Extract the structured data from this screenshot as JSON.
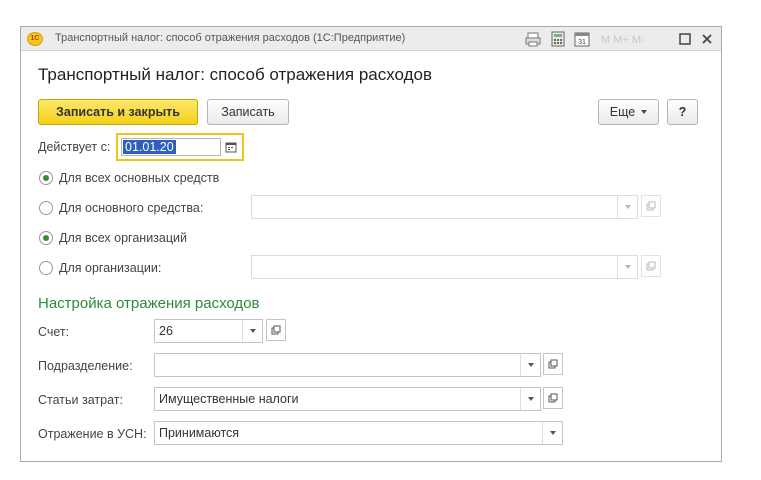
{
  "window": {
    "title": "Транспортный налог: способ отражения расходов  (1С:Предприятие)",
    "logo_text": "1С"
  },
  "titlebar_icons": [
    "print-icon",
    "calculator-icon",
    "calendar-icon",
    "m-icons",
    "maximize-icon",
    "close-icon"
  ],
  "form": {
    "title": "Транспортный налог: способ отражения расходов"
  },
  "toolbar": {
    "save_close_label": "Записать и закрыть",
    "save_label": "Записать",
    "more_label": "Еще",
    "help_label": "?"
  },
  "valid_from": {
    "label": "Действует с:",
    "value": "01.01.20"
  },
  "options": {
    "all_assets": {
      "label": "Для всех основных средств",
      "checked": true
    },
    "one_asset": {
      "label": "Для основного средства:",
      "checked": false,
      "value": ""
    },
    "all_orgs": {
      "label": "Для всех организаций",
      "checked": true
    },
    "one_org": {
      "label": "Для организации:",
      "checked": false,
      "value": ""
    }
  },
  "expenses": {
    "section_title": "Настройка отражения расходов",
    "account": {
      "label": "Счет:",
      "value": "26"
    },
    "department": {
      "label": "Подразделение:",
      "value": ""
    },
    "cost_item": {
      "label": "Статьи затрат:",
      "value": "Имущественные налоги"
    },
    "usn": {
      "label": "Отражение в УСН:",
      "value": "Принимаются"
    }
  },
  "colors": {
    "accent_yellow": "#f4d11a",
    "section_green": "#2e8b3a",
    "selection_blue": "#2f5fbd"
  }
}
